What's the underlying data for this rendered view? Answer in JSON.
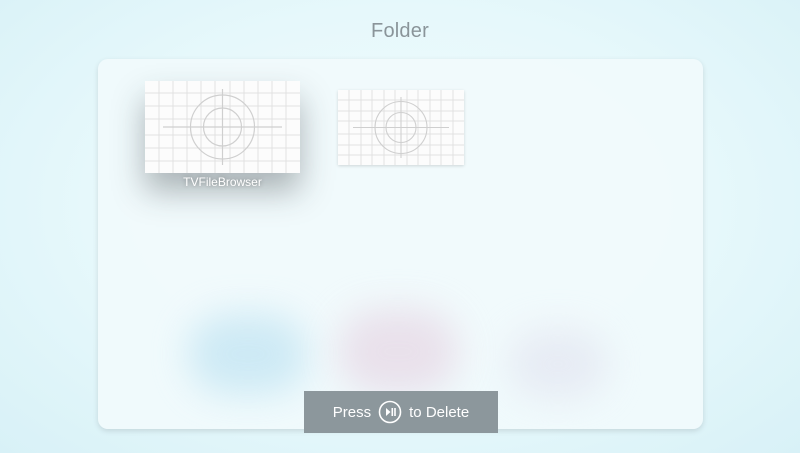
{
  "folder": {
    "title": "Folder"
  },
  "apps": [
    {
      "label": "TVFileBrowser",
      "focused": true,
      "icon": "test-pattern-icon"
    },
    {
      "label": "",
      "focused": false,
      "icon": "test-pattern-icon"
    }
  ],
  "hint": {
    "before": "Press",
    "icon": "play-pause-icon",
    "after": "to Delete"
  },
  "colors": {
    "background": "#e6f8fb",
    "panel": "#f1fafc",
    "title_text": "#8a9499",
    "hint_bar": "#8c979c"
  }
}
